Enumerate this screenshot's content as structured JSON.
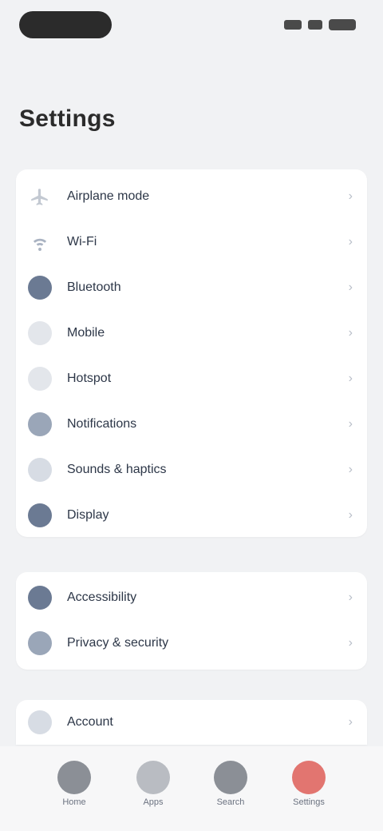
{
  "status_bar": {
    "icons": [
      "signal-icon",
      "wifi-icon",
      "battery-icon"
    ]
  },
  "page": {
    "title": "Settings"
  },
  "main_list": [
    {
      "icon": "airplane-icon",
      "label": "Airplane mode"
    },
    {
      "icon": "wifi-icon",
      "label": "Wi-Fi"
    },
    {
      "icon": "bluetooth-icon",
      "label": "Bluetooth"
    },
    {
      "icon": "mobile-icon",
      "label": "Mobile"
    },
    {
      "icon": "hotspot-icon",
      "label": "Hotspot"
    },
    {
      "icon": "notifications-icon",
      "label": "Notifications"
    },
    {
      "icon": "sound-icon",
      "label": "Sounds & haptics"
    },
    {
      "icon": "display-icon",
      "label": "Display"
    }
  ],
  "secondary_list": [
    {
      "icon": "accessibility-icon",
      "label": "Accessibility"
    },
    {
      "icon": "privacy-icon",
      "label": "Privacy & security"
    }
  ],
  "partial_list": [
    {
      "icon": "account-icon",
      "label": "Account"
    }
  ],
  "tab_bar": [
    {
      "icon": "home-icon",
      "label": "Home"
    },
    {
      "icon": "apps-icon",
      "label": "Apps"
    },
    {
      "icon": "search-icon",
      "label": "Search"
    },
    {
      "icon": "settings-icon",
      "label": "Settings"
    }
  ],
  "colors": {
    "background": "#f1f2f4",
    "card": "#ffffff",
    "accent_red": "#e27570"
  }
}
